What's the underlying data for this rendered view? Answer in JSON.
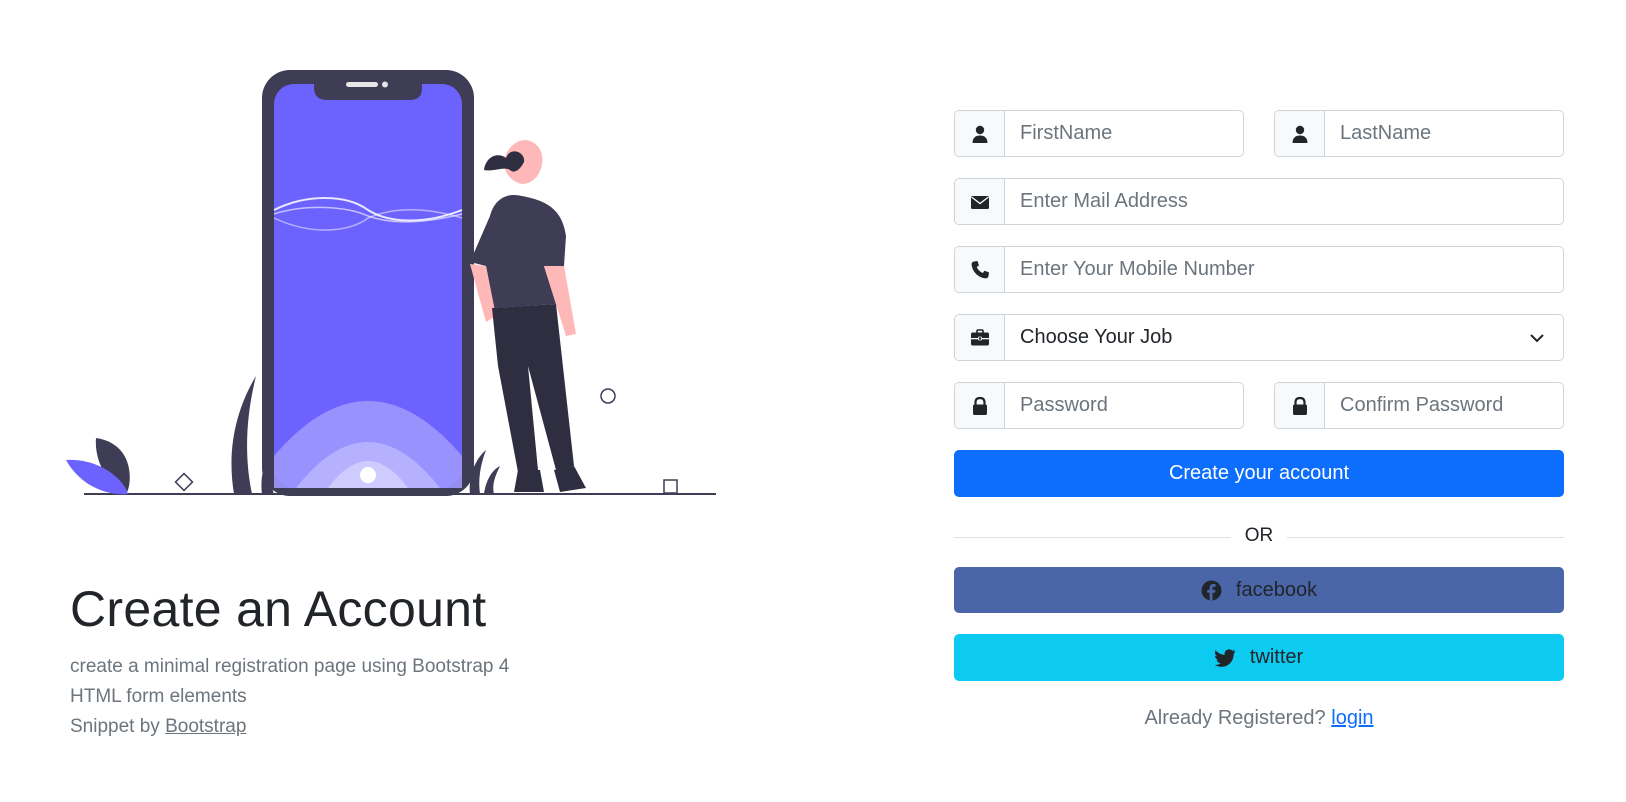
{
  "hero": {
    "title": "Create an Account",
    "line1": "create a minimal registration page using Bootstrap 4",
    "line2": "HTML form elements",
    "snippet_prefix": "Snippet by ",
    "snippet_link": "Bootstrap"
  },
  "form": {
    "first_name_placeholder": "FirstName",
    "last_name_placeholder": "LastName",
    "email_placeholder": "Enter Mail Address",
    "mobile_placeholder": "Enter Your Mobile Number",
    "job_selected": "Choose Your Job",
    "password_placeholder": "Password",
    "confirm_password_placeholder": "Confirm Password",
    "submit_label": "Create your account",
    "or_label": "OR",
    "facebook_label": "facebook",
    "twitter_label": "twitter",
    "already_registered": "Already Registered?",
    "login_link": "login"
  },
  "icons": {
    "first_name": "user-icon",
    "last_name": "user-icon",
    "email": "envelope-icon",
    "mobile": "phone-icon",
    "job": "briefcase-icon",
    "password": "lock-icon",
    "confirm_password": "lock-icon",
    "facebook": "facebook-icon",
    "twitter": "twitter-icon"
  },
  "colors": {
    "primary": "#0d6efd",
    "facebook": "#4a66a8",
    "twitter": "#0dcaf0",
    "illustration_accent": "#6c63ff",
    "illustration_dark": "#3f3d56"
  }
}
